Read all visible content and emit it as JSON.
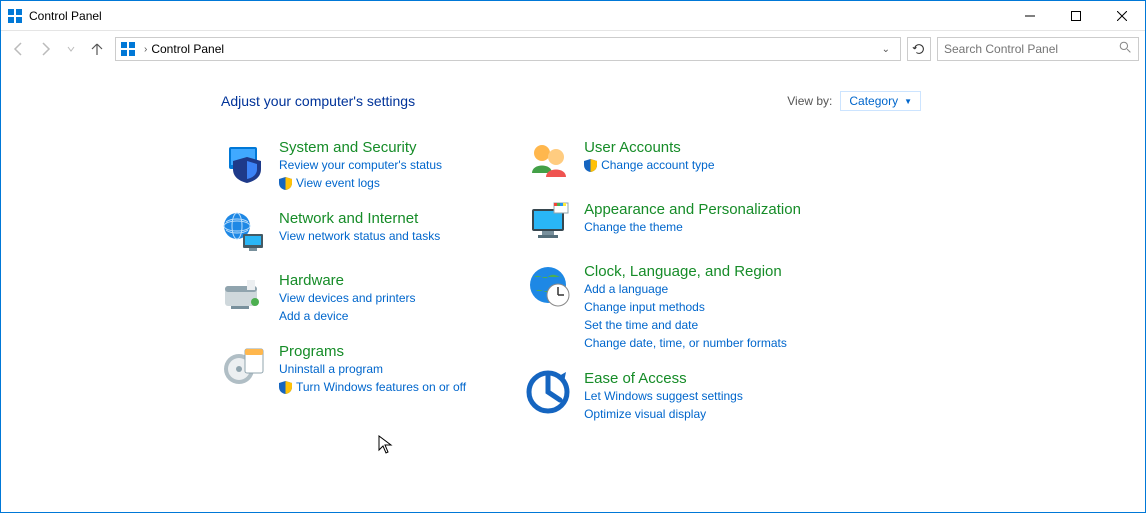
{
  "window": {
    "title": "Control Panel"
  },
  "navbar": {
    "breadcrumb": "Control Panel",
    "search_placeholder": "Search Control Panel"
  },
  "content": {
    "heading": "Adjust your computer's settings",
    "viewby_label": "View by:",
    "viewby_value": "Category"
  },
  "categories": {
    "left": [
      {
        "title": "System and Security",
        "links": [
          {
            "text": "Review your computer's status",
            "shield": false
          },
          {
            "text": "View event logs",
            "shield": true
          }
        ],
        "icon": "system-security-icon"
      },
      {
        "title": "Network and Internet",
        "links": [
          {
            "text": "View network status and tasks",
            "shield": false
          }
        ],
        "icon": "network-internet-icon"
      },
      {
        "title": "Hardware",
        "links": [
          {
            "text": "View devices and printers",
            "shield": false
          },
          {
            "text": "Add a device",
            "shield": false
          }
        ],
        "icon": "hardware-icon"
      },
      {
        "title": "Programs",
        "links": [
          {
            "text": "Uninstall a program",
            "shield": false
          },
          {
            "text": "Turn Windows features on or off",
            "shield": true
          }
        ],
        "icon": "programs-icon"
      }
    ],
    "right": [
      {
        "title": "User Accounts",
        "links": [
          {
            "text": "Change account type",
            "shield": true
          }
        ],
        "icon": "user-accounts-icon"
      },
      {
        "title": "Appearance and Personalization",
        "links": [
          {
            "text": "Change the theme",
            "shield": false
          }
        ],
        "icon": "appearance-icon"
      },
      {
        "title": "Clock, Language, and Region",
        "links": [
          {
            "text": "Add a language",
            "shield": false
          },
          {
            "text": "Change input methods",
            "shield": false
          },
          {
            "text": "Set the time and date",
            "shield": false
          },
          {
            "text": "Change date, time, or number formats",
            "shield": false
          }
        ],
        "icon": "clock-region-icon"
      },
      {
        "title": "Ease of Access",
        "links": [
          {
            "text": "Let Windows suggest settings",
            "shield": false
          },
          {
            "text": "Optimize visual display",
            "shield": false
          }
        ],
        "icon": "ease-access-icon"
      }
    ]
  }
}
